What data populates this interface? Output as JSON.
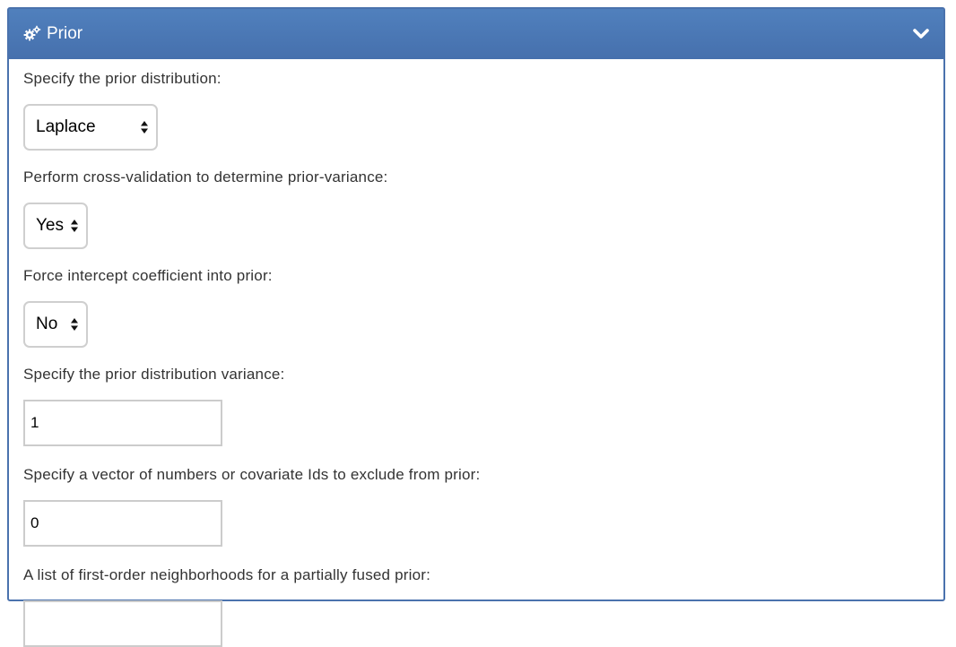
{
  "panel": {
    "title": "Prior",
    "header_icon": "gears-icon",
    "toggle_icon": "chevron-down-icon",
    "header_color": "#4a78b5"
  },
  "fields": {
    "prior_distribution": {
      "label": "Specify the prior distribution:",
      "selected": "Laplace"
    },
    "cross_validation": {
      "label": "Perform cross-validation to determine prior-variance:",
      "selected": "Yes"
    },
    "force_intercept": {
      "label": "Force intercept coefficient into prior:",
      "selected": "No"
    },
    "prior_variance": {
      "label": "Specify the prior distribution variance:",
      "value": "1"
    },
    "exclude": {
      "label": "Specify a vector of numbers or covariate Ids to exclude from prior:",
      "value": "0"
    },
    "neighborhoods": {
      "label": "A list of first-order neighborhoods for a partially fused prior:",
      "value": ""
    }
  }
}
